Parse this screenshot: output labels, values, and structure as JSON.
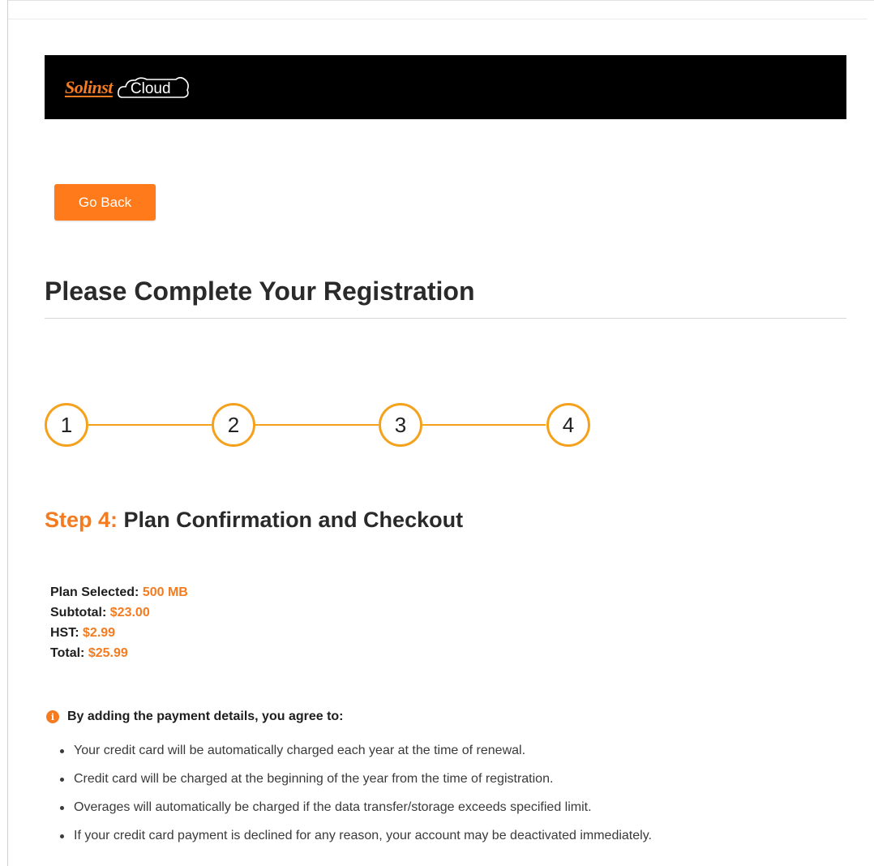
{
  "header": {
    "logo_brand": "Solinst",
    "logo_product": "Cloud"
  },
  "actions": {
    "go_back_label": "Go Back"
  },
  "page": {
    "title": "Please Complete Your Registration"
  },
  "stepper": {
    "steps": [
      "1",
      "2",
      "3",
      "4"
    ],
    "current_step": 4
  },
  "step": {
    "label": "Step 4:",
    "title": "Plan Confirmation and Checkout"
  },
  "summary": {
    "plan_label": "Plan Selected:",
    "plan_value": "500 MB",
    "subtotal_label": "Subtotal:",
    "subtotal_value": "$23.00",
    "hst_label": "HST:",
    "hst_value": "$2.99",
    "total_label": "Total:",
    "total_value": "$25.99"
  },
  "agreement": {
    "heading": "By adding the payment details, you agree to:",
    "terms": [
      "Your credit card will be automatically charged each year at the time of renewal.",
      "Credit card will be charged at the beginning of the year from the time of registration.",
      "Overages will automatically be charged if the data transfer/storage exceeds specified limit.",
      "If your credit card payment is declined for any reason, your account may be deactivated immediately."
    ]
  },
  "colors": {
    "accent": "#f47b20",
    "button": "#ff7a1a",
    "stepper": "#f5a11c",
    "header_bg": "#000000"
  }
}
